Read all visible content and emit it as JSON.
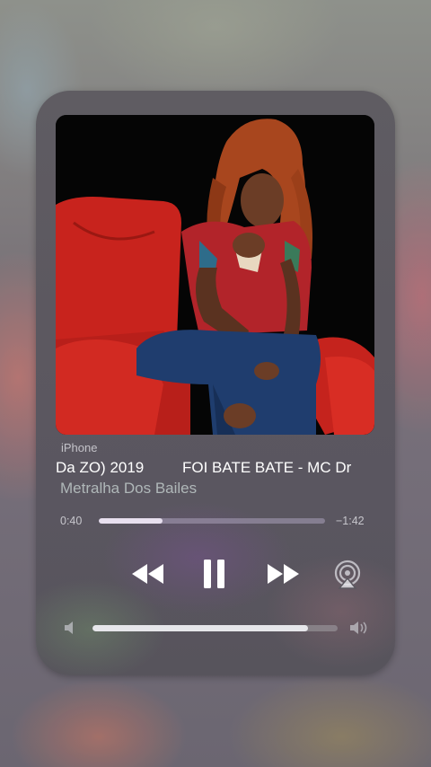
{
  "player": {
    "source": "iPhone",
    "title_part1": "Da ZO) 2019",
    "title_part2": "FOI BATE BATE - MC Dr",
    "artist": "Metralha Dos Bailes",
    "elapsed": "0:40",
    "remaining": "−1:42",
    "progress": 0.28,
    "volume": 0.88
  },
  "icons": {
    "rewind": "rewind-icon",
    "pause": "pause-icon",
    "fast_forward": "fast-forward-icon",
    "airplay": "airplay-icon",
    "volume_low": "speaker-low-icon",
    "volume_high": "speaker-high-icon"
  },
  "colors": {
    "accent_fill": "#e8e0ef",
    "chair_red": "#d4261f"
  }
}
